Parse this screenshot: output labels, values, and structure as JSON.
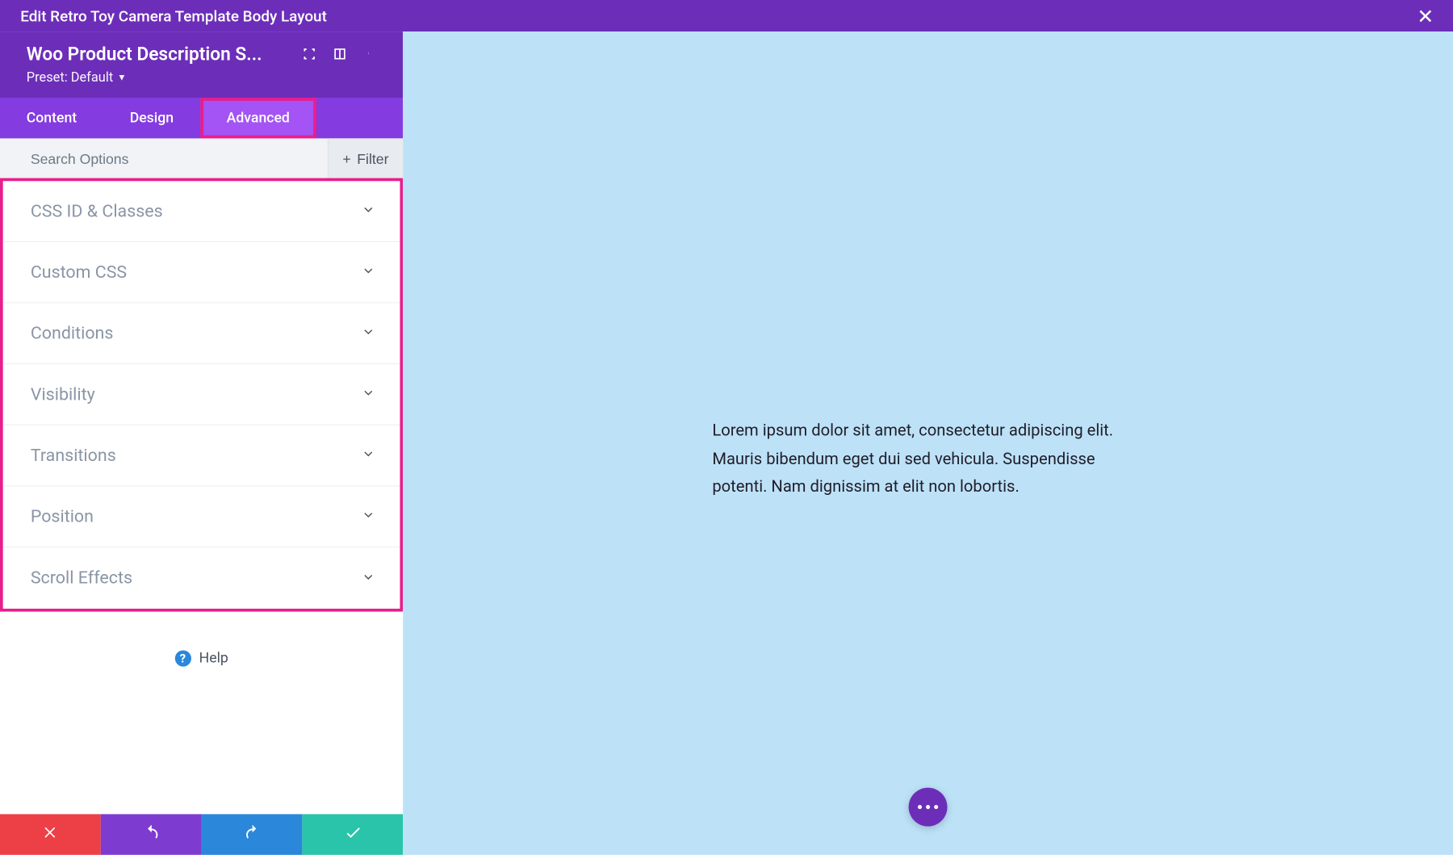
{
  "topbar": {
    "title": "Edit Retro Toy Camera Template Body Layout"
  },
  "sidebar": {
    "module_title": "Woo Product Description S...",
    "preset_label": "Preset: Default",
    "tabs": {
      "content": "Content",
      "design": "Design",
      "advanced": "Advanced"
    },
    "search_placeholder": "Search Options",
    "filter_label": "Filter",
    "panels": [
      {
        "label": "CSS ID & Classes"
      },
      {
        "label": "Custom CSS"
      },
      {
        "label": "Conditions"
      },
      {
        "label": "Visibility"
      },
      {
        "label": "Transitions"
      },
      {
        "label": "Position"
      },
      {
        "label": "Scroll Effects"
      }
    ],
    "help_label": "Help"
  },
  "canvas": {
    "body_text": "Lorem ipsum dolor sit amet, consectetur adipiscing elit. Mauris bibendum eget dui sed vehicula. Suspendisse potenti. Nam dignissim at elit non lobortis."
  },
  "colors": {
    "primary_purple": "#6c2eb9",
    "tab_purple": "#843BE0",
    "tab_active": "#A453F4",
    "highlight_pink": "#E91E8C",
    "cancel_red": "#ED3F46",
    "undo_purple": "#7E3BD0",
    "redo_blue": "#2B87DA",
    "save_teal": "#29C4A9",
    "canvas_blue": "#bde2f8"
  }
}
